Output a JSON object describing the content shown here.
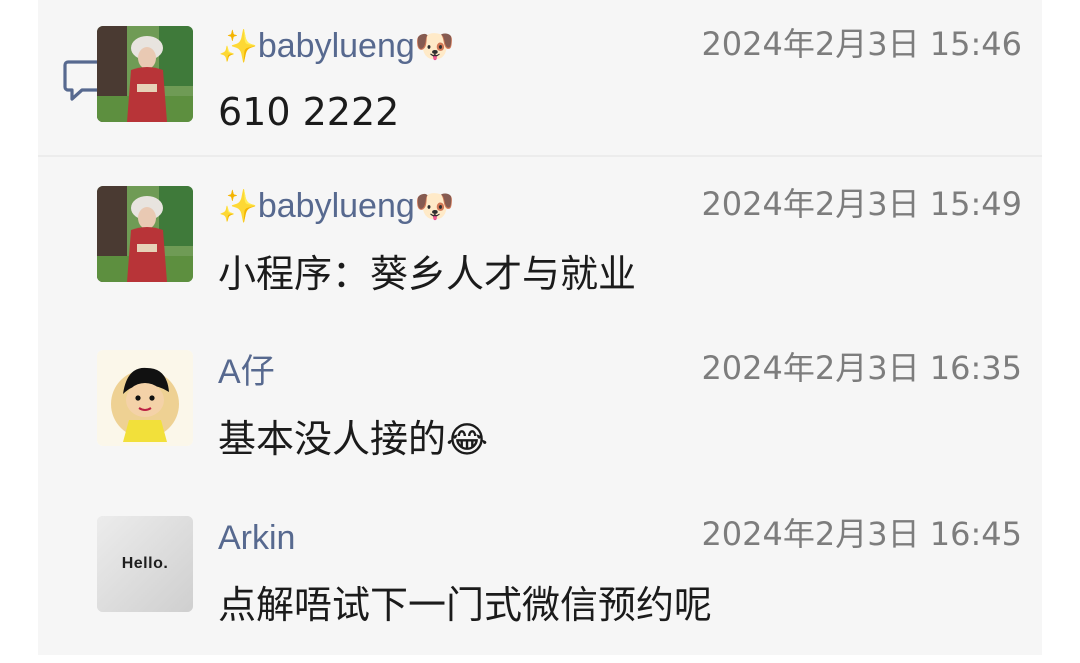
{
  "messages": [
    {
      "name": "babylueng",
      "name_prefix_emoji": "✨",
      "name_suffix_emoji": "🐶",
      "time": "2024年2月3日 15:46",
      "text": "610 2222",
      "text_emoji": "",
      "avatar": "photo-woman-red-costume"
    },
    {
      "name": "babylueng",
      "name_prefix_emoji": "✨",
      "name_suffix_emoji": "🐶",
      "time": "2024年2月3日 15:49",
      "text": "小程序：葵乡人才与就业",
      "text_emoji": "",
      "avatar": "photo-woman-red-costume"
    },
    {
      "name": "A仔",
      "name_prefix_emoji": "",
      "name_suffix_emoji": "",
      "time": "2024年2月3日 16:35",
      "text": "基本没人接的",
      "text_emoji": "😂",
      "avatar": "cartoon-boy"
    },
    {
      "name": "Arkin",
      "name_prefix_emoji": "",
      "name_suffix_emoji": "",
      "time": "2024年2月3日 16:45",
      "text": "点解唔试下一门式微信预约呢",
      "text_emoji": "",
      "avatar": "hello-text-avatar",
      "avatar_text": "Hello."
    }
  ],
  "icons": {
    "comment": "comment-bubble-icon"
  },
  "colors": {
    "panel_bg": "#f6f6f6",
    "name": "#57698f",
    "time": "#7d7d7d",
    "message": "#1b1b1b",
    "icon": "#57698f"
  }
}
